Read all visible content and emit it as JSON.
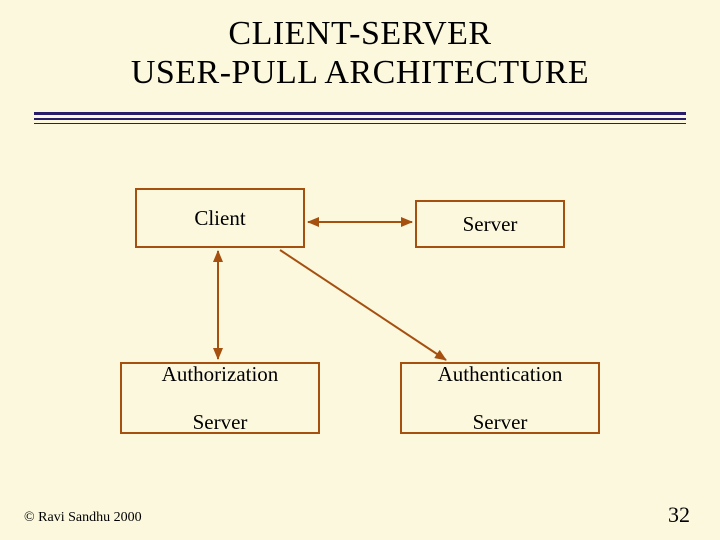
{
  "title_line1": "CLIENT-SERVER",
  "title_line2": "USER-PULL ARCHITECTURE",
  "boxes": {
    "client": "Client",
    "server": "Server",
    "authz_l1": "Authorization",
    "authz_l2": "Server",
    "authn_l1": "Authentication",
    "authn_l2": "Server"
  },
  "footer": {
    "copyright": "© Ravi Sandhu 2000",
    "page": "32"
  },
  "colors": {
    "bg": "#fbf8de",
    "box_border": "#a6500f",
    "arrow": "#a6500f",
    "divider": "#2a1d6a"
  },
  "arrows": [
    {
      "from": "client",
      "to": "server",
      "bidirectional": true
    },
    {
      "from": "client",
      "to": "authorization-server",
      "bidirectional": true
    },
    {
      "from": "client",
      "to": "authentication-server",
      "bidirectional": false,
      "diagonal": true
    }
  ]
}
